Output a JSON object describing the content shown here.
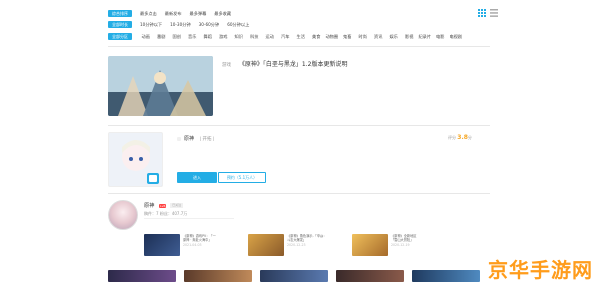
{
  "filters": {
    "sort": {
      "label": "综合排序",
      "options": [
        "最多点击",
        "最新发布",
        "最多弹幕",
        "最多收藏"
      ]
    },
    "duration": {
      "label": "全部时长",
      "options": [
        "10分钟以下",
        "10-30分钟",
        "30-60分钟",
        "60分钟以上"
      ]
    },
    "category": {
      "label": "全部分区",
      "options": [
        "动画",
        "番剧",
        "国创",
        "音乐",
        "舞蹈",
        "游戏",
        "知识",
        "科技",
        "运动",
        "汽车",
        "生活",
        "美食",
        "动物圈",
        "鬼畜",
        "时尚",
        "资讯",
        "娱乐",
        "影视",
        "纪录片",
        "电影",
        "电视剧"
      ]
    }
  },
  "results": {
    "video": {
      "category": "游戏",
      "title": "《原神》「白垩与黑龙」1.2版本更新说明"
    },
    "game": {
      "name": "原神",
      "tagline": "| 开拓 |",
      "score_label": "评分",
      "score": "3.8",
      "score_unit": "分",
      "enter_label": "进入",
      "reserve_label": "预约（5.1万人）"
    },
    "upper": {
      "name": "原神",
      "level": "Lv6",
      "follow_tag": "已关注",
      "stats": "稿件：7   粉丝：407.7万",
      "videos": [
        {
          "title": "《原神》游戏PV：「一",
          "subtitle": "原神 · 奔赴火海中」",
          "date": "2021-04-03"
        },
        {
          "title": "《原神》角色演示-「辛焱：",
          "subtitle": "斗志大爆发」",
          "date": "2020-12-23"
        },
        {
          "title": "《原神》全新地区",
          "subtitle": "「雪山大冒险」",
          "date": "2020-12-19"
        },
        {
          "title": "",
          "subtitle": "",
          "date": ""
        }
      ]
    }
  },
  "watermark": "京华手游网",
  "icons": {
    "grid": "grid-view-icon",
    "list": "list-view-icon"
  },
  "colors": {
    "accent": "#23ade5",
    "score": "#f5a623",
    "watermark": "#ff9c1b"
  }
}
